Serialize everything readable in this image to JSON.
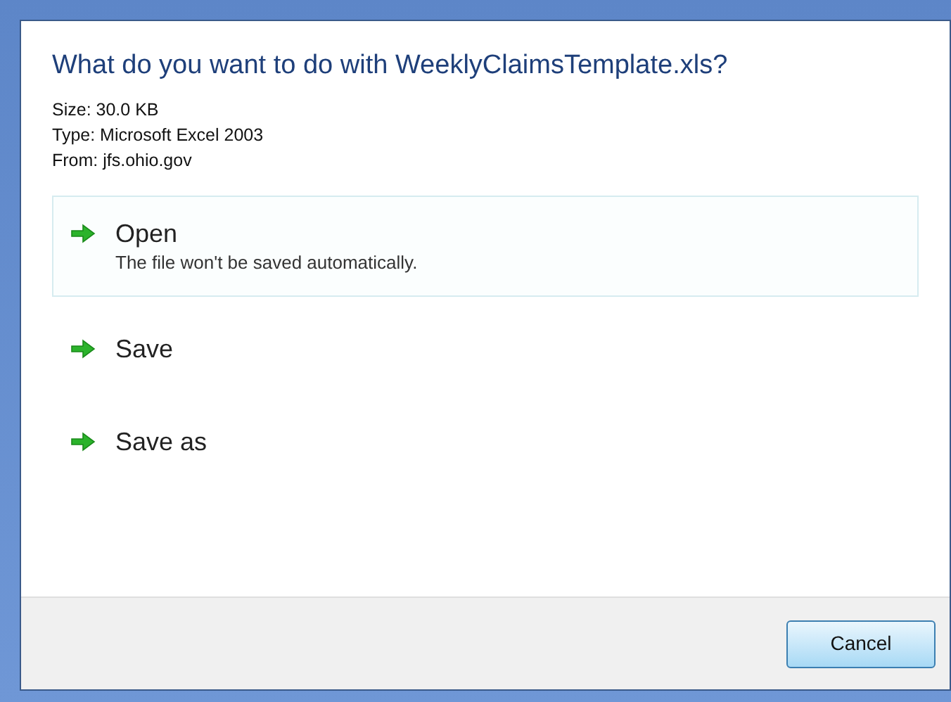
{
  "dialog": {
    "title": "What do you want to do with WeeklyClaimsTemplate.xls?",
    "info": [
      "Size: 30.0 KB",
      "Type: Microsoft Excel 2003",
      "From: jfs.ohio.gov"
    ],
    "options": [
      {
        "label": "Open",
        "description": "The file won't be saved automatically.",
        "selected": true
      },
      {
        "label": "Save",
        "selected": false
      },
      {
        "label": "Save as",
        "selected": false
      }
    ],
    "buttons": [
      "Cancel"
    ]
  }
}
